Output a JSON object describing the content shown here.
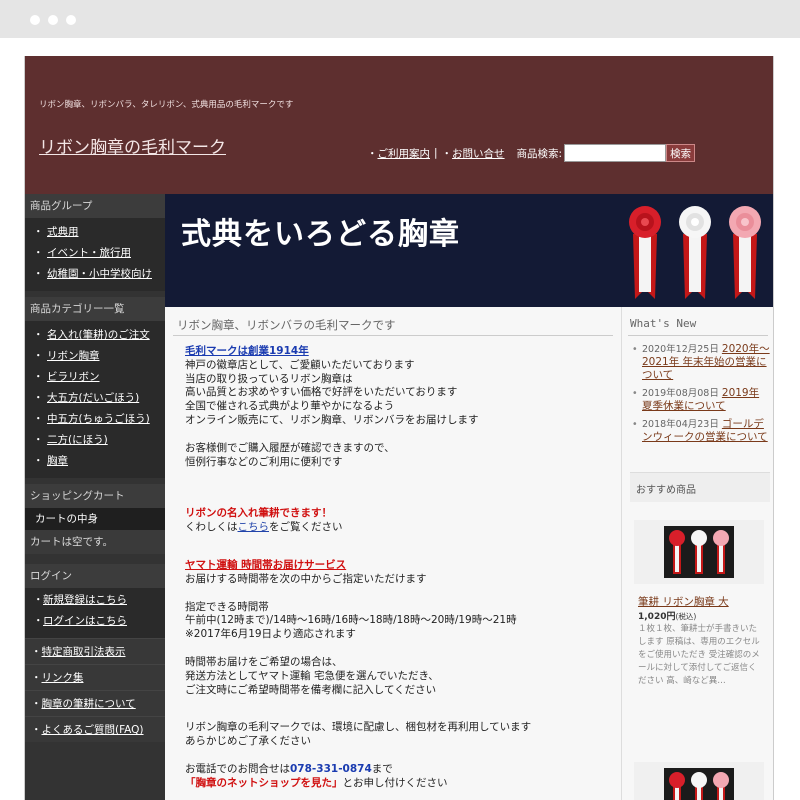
{
  "header": {
    "tagline": "リボン胸章、リボンバラ、タレリボン、式典用品の毛利マークです",
    "site_title": "リボン胸章の毛利マーク",
    "nav": {
      "guide": "ご利用案内",
      "contact": "お問い合せ",
      "search_label": "商品検索:",
      "search_button": "検索"
    }
  },
  "sidebar": {
    "groups_heading": "商品グループ",
    "groups": [
      "式典用",
      "イベント・旅行用",
      "幼稚園・小中学校向け"
    ],
    "categories_heading": "商品カテゴリー一覧",
    "categories": [
      "名入れ(筆耕)のご注文",
      "リボン胸章",
      "ビラリボン",
      "大五方(だいごほう)",
      "中五方(ちゅうごほう)",
      "二方(にほう)",
      "胸章"
    ],
    "cart_heading": "ショッピングカート",
    "cart_subheading": "カートの中身",
    "cart_empty": "カートは空です。",
    "login_heading": "ログイン",
    "login_links": [
      "新規登録はこちら",
      "ログインはこちら"
    ],
    "links": [
      "特定商取引法表示",
      "リンク集",
      "胸章の筆耕について",
      "よくあるご質問(FAQ)"
    ]
  },
  "banner": {
    "text": "式典をいろどる胸章"
  },
  "main": {
    "title": "リボン胸章、リボンバラの毛利マークです",
    "founded": "毛利マークは創業1914年",
    "intro": [
      "神戸の徽章店として、ご愛顧いただいております",
      "当店の取り扱っているリボン胸章は",
      "高い品質とお求めやすい価格で好評をいただいております",
      "全国で催される式典がより華やかになるよう",
      "オンライン販売にて、リボン胸章、リボンバラをお届けします"
    ],
    "history": [
      "お客様側でご購入履歴が確認できますので、",
      "恒例行事などのご利用に便利です"
    ],
    "name_service": "リボンの名入れ筆耕できます！",
    "details_pre": "くわしくは",
    "details_link": "こちら",
    "details_post": "をご覧ください",
    "delivery_title": "ヤマト運輸 時間帯お届けサービス",
    "delivery_lead": "お届けする時間帯を次の中からご指定いただけます",
    "time_heading": "指定できる時間帯",
    "time_slots": "午前中(12時まで)/14時～16時/16時～18時/18時～20時/19時～21時",
    "time_note": "※2017年6月19日より適応されます",
    "time_request": [
      "時間帯お届けをご希望の場合は、",
      "発送方法としてヤマト運輸 宅急便を選んでいただき、",
      "ご注文時にご希望時間帯を備考欄に記入してください"
    ],
    "eco": [
      "リボン胸章の毛利マークでは、環境に配慮し、梱包材を再利用しています",
      "あらかじめご了承ください"
    ],
    "phone_pre": "お電話でのお問合せは",
    "phone": "078-331-0874",
    "phone_post": "まで",
    "shop_link": "「胸章のネットショップを見た」",
    "shop_post": "とお申し付けください"
  },
  "news": {
    "title": "What's New",
    "items": [
      {
        "date": "2020年12月25日",
        "title": "2020年～2021年 年末年始の営業について"
      },
      {
        "date": "2019年08月08日",
        "title": "2019年 夏季休業について"
      },
      {
        "date": "2018年04月23日",
        "title": "ゴールデンウィークの営業について"
      }
    ]
  },
  "recommend": {
    "title": "おすすめ商品",
    "product": {
      "name": "筆耕 リボン胸章 大",
      "price": "1,020円",
      "tax": "(税込)",
      "desc": "１枚１枚、筆耕士が手書きいたします 原稿は、専用のエクセルをご使用いただき 受注確認のメールに対して添付してご返信ください 高、崎など異…"
    }
  },
  "colors": {
    "header_bg": "#5e2f2f",
    "sidebar_bg": "#333333",
    "banner_bg": "#131a35",
    "accent_red": "#d01010",
    "link_blue": "#1a3bb0"
  }
}
